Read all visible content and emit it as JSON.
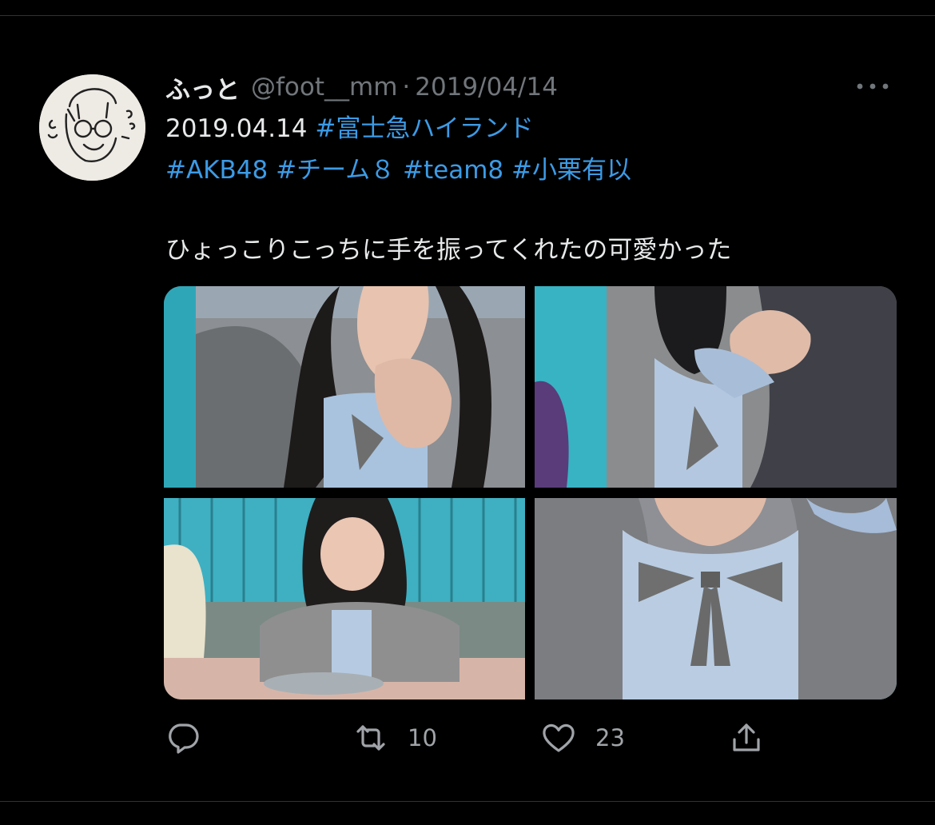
{
  "tweet": {
    "author": {
      "display_name": "ふっと",
      "handle": "@foot__mm",
      "avatar_icon": "hand-drawn-face-avatar"
    },
    "separator": "·",
    "date": "2019/04/14",
    "text_lines": [
      [
        {
          "text": "2019.04.14 ",
          "kind": "plain"
        },
        {
          "text": "#富士急ハイランド",
          "kind": "hashtag"
        }
      ],
      [
        {
          "text": "#AKB48",
          "kind": "hashtag"
        },
        {
          "text": " ",
          "kind": "plain"
        },
        {
          "text": "#チーム８",
          "kind": "hashtag"
        },
        {
          "text": " ",
          "kind": "plain"
        },
        {
          "text": "#team8",
          "kind": "hashtag"
        },
        {
          "text": " ",
          "kind": "plain"
        },
        {
          "text": "#小栗有以",
          "kind": "hashtag"
        }
      ],
      [
        {
          "text": "ひょっこりこっちに手を振ってくれたの可愛かった",
          "kind": "plain"
        }
      ]
    ],
    "media": [
      {
        "name": "photo-waving-closeup"
      },
      {
        "name": "photo-raised-hand-closeup"
      },
      {
        "name": "photo-teacup-ride"
      },
      {
        "name": "photo-bow-ribbon-closeup"
      }
    ],
    "actions": {
      "reply": {
        "icon": "reply-bubble-icon",
        "count": ""
      },
      "retweet": {
        "icon": "retweet-icon",
        "count": "10"
      },
      "like": {
        "icon": "heart-icon",
        "count": "23"
      },
      "share": {
        "icon": "share-upload-icon",
        "count": ""
      }
    },
    "more_icon": "more-dots-icon"
  },
  "colors": {
    "background": "#000000",
    "text": "#e7e9ea",
    "secondary": "#71767b",
    "hashtag": "#3c9be6",
    "divider": "#2f3336"
  }
}
